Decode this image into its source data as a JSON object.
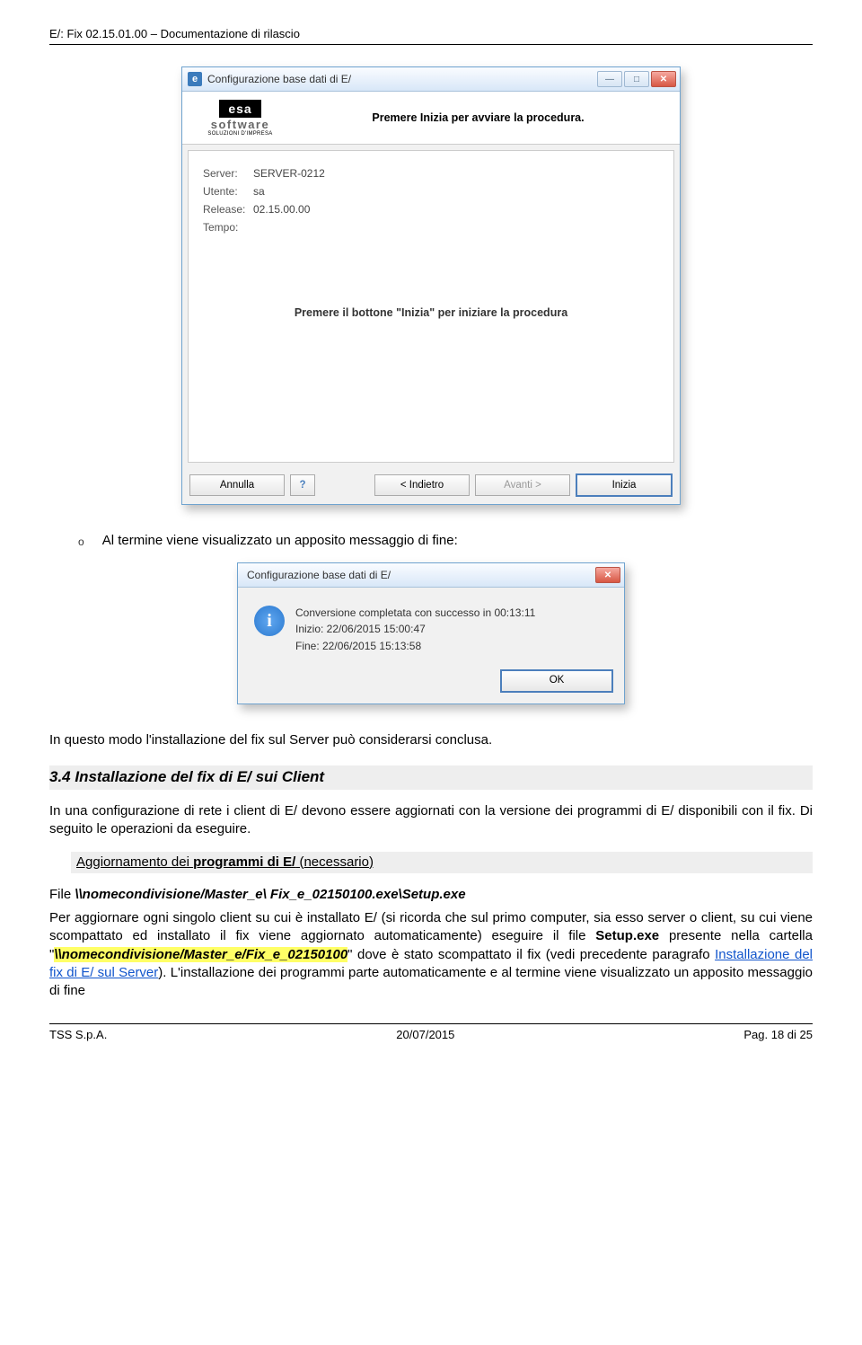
{
  "header": {
    "title": "E/: Fix 02.15.01.00 – Documentazione di rilascio"
  },
  "wizard": {
    "title": "Configurazione base dati di E/",
    "logo": {
      "brand": "esa",
      "brand2": "software",
      "tag": "SOLUZIONI D'IMPRESA"
    },
    "headerTitle": "Premere Inizia per avviare la procedura.",
    "fields": {
      "serverLabel": "Server:",
      "serverValue": "SERVER-0212",
      "userLabel": "Utente:",
      "userValue": "sa",
      "releaseLabel": "Release:",
      "releaseValue": "02.15.00.00",
      "tempoLabel": "Tempo:",
      "tempoValue": ""
    },
    "centerMsg": "Premere il bottone \"Inizia\" per iniziare la procedura",
    "buttons": {
      "annulla": "Annulla",
      "help": "?",
      "indietro": "< Indietro",
      "avanti": "Avanti >",
      "inizia": "Inizia"
    }
  },
  "bullet1": {
    "marker": "o",
    "text": "Al termine viene visualizzato un apposito messaggio di fine:"
  },
  "dialog": {
    "title": "Configurazione base dati di E/",
    "line1": "Conversione completata con successo in 00:13:11",
    "line2": "Inizio: 22/06/2015 15:00:47",
    "line3": "Fine: 22/06/2015 15:13:58",
    "ok": "OK"
  },
  "para1": "In questo modo l'installazione del fix sul Server può considerarsi conclusa.",
  "sec34": {
    "title": "3.4   Installazione del fix di E/ sui Client",
    "p1": "In una configurazione di rete i client di E/ devono essere aggiornati con la versione dei programmi di E/ disponibili con il fix. Di seguito le operazioni da eseguire.",
    "sub": {
      "pre": "Aggiornamento dei ",
      "bold": "programmi di E/",
      "post": " (necessario)"
    },
    "path": {
      "pre": "File ",
      "ital": "\\\\nomecondivisione/Master_e\\ Fix_e_02150100.exe\\Setup.exe"
    },
    "body": {
      "a": "Per aggiornare ogni singolo client su cui è installato E/ (si ricorda che sul primo computer, sia esso server o client, su cui viene scompattato ed installato il fix viene aggiornato automaticamente) eseguire il file ",
      "setup": "Setup.exe",
      "b": " presente nella cartella \"",
      "hl": "\\\\nomecondivisione/Master_e/Fix_e_02150100",
      "c": "\" dove è stato scompattato il fix (vedi precedente paragrafo ",
      "link": "Installazione del fix di E/ sul Server",
      "d": "). L'installazione dei programmi parte automaticamente e al termine viene visualizzato un apposito messaggio di fine"
    }
  },
  "footer": {
    "left": "TSS S.p.A.",
    "center": "20/07/2015",
    "right": "Pag. 18 di 25"
  }
}
